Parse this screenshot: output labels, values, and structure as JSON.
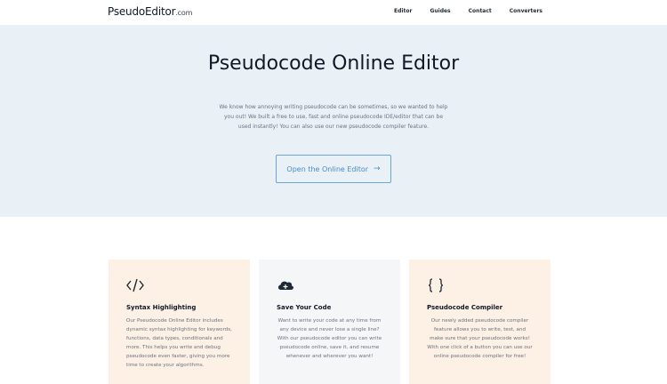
{
  "navbar": {
    "brand_main": "PseudoEditor",
    "brand_tld": ".com",
    "links": [
      "Editor",
      "Guides",
      "Contact",
      "Converters"
    ]
  },
  "hero": {
    "title": "Pseudocode Online Editor",
    "description": "We know how annoying writing pseudocode can be sometimes, so we wanted to help you out! We built a free to use, fast and online pseudocode IDE/editor that can be used instantly! You can also use our new pseudocode compiler feature.",
    "cta_label": "Open the Online Editor",
    "cta_arrow": "→"
  },
  "features": [
    {
      "icon": "code-tag-icon",
      "icon_glyph": "</>",
      "title": "Syntax Highlighting",
      "text": "Our Pseudocode Online Editor includes dynamic syntax highlighting for keywords, functions, data types, conditionals and more. This helps you write and debug pseudocode even faster, giving you more time to create your algorithms."
    },
    {
      "icon": "cloud-upload-icon",
      "icon_glyph": "☁",
      "title": "Save Your Code",
      "text": "Want to write your code at any time from any device and never lose a single line? With our pseudocode editor you can write pseudocode online, save it, and resume whenever and wherever you want!"
    },
    {
      "icon": "curly-braces-icon",
      "icon_glyph": "{ }",
      "title": "Pseudocode Compiler",
      "text": "Our newly added pseudocode compiler feature allows you to write, test, and make sure that your pseudocode works! With one click of a button you can use our online pseudocode compiler for free!"
    }
  ],
  "colors": {
    "hero_bg": "#e9f0f6",
    "card_warm": "#fdf0e4",
    "card_cool": "#f5f6f8",
    "accent": "#4a8bc8"
  }
}
